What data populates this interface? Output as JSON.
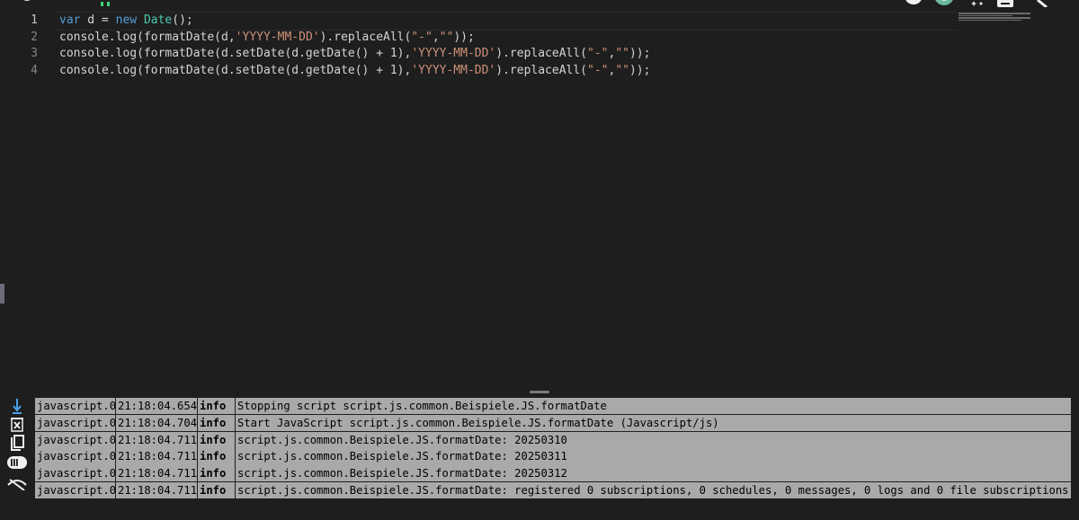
{
  "editor": {
    "line_numbers": [
      "1",
      "2",
      "3",
      "4"
    ],
    "lines": [
      [
        {
          "t": "var",
          "c": "kw"
        },
        {
          "t": " d = ",
          "c": ""
        },
        {
          "t": "new",
          "c": "kw"
        },
        {
          "t": " ",
          "c": ""
        },
        {
          "t": "Date",
          "c": "ty"
        },
        {
          "t": "();",
          "c": ""
        }
      ],
      [
        {
          "t": "console.log(formatDate(d,",
          "c": ""
        },
        {
          "t": "'YYYY-MM-DD'",
          "c": "st"
        },
        {
          "t": ").replaceAll(",
          "c": ""
        },
        {
          "t": "\"-\"",
          "c": "st"
        },
        {
          "t": ",",
          "c": ""
        },
        {
          "t": "\"\"",
          "c": "st"
        },
        {
          "t": "));",
          "c": ""
        }
      ],
      [
        {
          "t": "console.log(formatDate(d.setDate(d.getDate() + 1),",
          "c": ""
        },
        {
          "t": "'YYYY-MM-DD'",
          "c": "st"
        },
        {
          "t": ").replaceAll(",
          "c": ""
        },
        {
          "t": "\"-\"",
          "c": "st"
        },
        {
          "t": ",",
          "c": ""
        },
        {
          "t": "\"\"",
          "c": "st"
        },
        {
          "t": "));",
          "c": ""
        }
      ],
      [
        {
          "t": "console.log(formatDate(d.setDate(d.getDate() + 1),",
          "c": ""
        },
        {
          "t": "'YYYY-MM-DD'",
          "c": "st"
        },
        {
          "t": ").replaceAll(",
          "c": ""
        },
        {
          "t": "\"-\"",
          "c": "st"
        },
        {
          "t": ",",
          "c": ""
        },
        {
          "t": "\"\"",
          "c": "st"
        },
        {
          "t": "));",
          "c": ""
        }
      ]
    ]
  },
  "toolbar": {
    "icons": [
      "scroll-down-icon",
      "clear-log-icon",
      "copy-icon",
      "toggle-details-icon",
      "hide-icon"
    ]
  },
  "log": {
    "rows": [
      {
        "source": "javascript.0",
        "time": "21:18:04.654",
        "level": "info",
        "message": "Stopping script script.js.common.Beispiele.JS.formatDate"
      },
      {
        "source": "javascript.0",
        "time": "21:18:04.704",
        "level": "info",
        "message": "Start JavaScript script.js.common.Beispiele.JS.formatDate (Javascript/js)"
      },
      {
        "source": "javascript.0",
        "time": "21:18:04.711",
        "level": "info",
        "message": "script.js.common.Beispiele.JS.formatDate: 20250310"
      },
      {
        "source": "javascript.0",
        "time": "21:18:04.711",
        "level": "info",
        "message": "script.js.common.Beispiele.JS.formatDate: 20250311"
      },
      {
        "source": "javascript.0",
        "time": "21:18:04.711",
        "level": "info",
        "message": "script.js.common.Beispiele.JS.formatDate: 20250312"
      },
      {
        "source": "javascript.0",
        "time": "21:18:04.711",
        "level": "info",
        "message": "script.js.common.Beispiele.JS.formatDate: registered 0 subscriptions, 0 schedules, 0 messages, 0 logs and 0 file subscriptions"
      }
    ]
  },
  "colors": {
    "editor_bg": "#1e1e1e",
    "keyword": "#569cd6",
    "type": "#4ec9b0",
    "string": "#ce9178",
    "log_row_bg": "#a9a9a9"
  }
}
